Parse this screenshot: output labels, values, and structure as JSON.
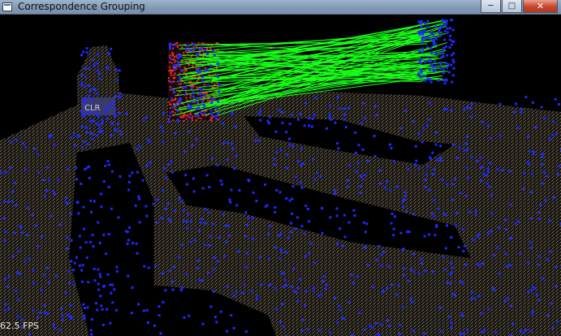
{
  "window": {
    "title": "Correspondence Grouping",
    "icon": "app-window-icon",
    "controls": {
      "minimize_glyph": "─",
      "maximize_glyph": "□",
      "close_glyph": "✕"
    }
  },
  "viewport": {
    "background": "#000000",
    "fps_text": "62.5 FPS",
    "colors": {
      "scene_points": "#8a7a5a",
      "keypoints": "#1f28ff",
      "model_points": "#ff2a1f",
      "correspondence_lines": "#19ff19"
    }
  }
}
